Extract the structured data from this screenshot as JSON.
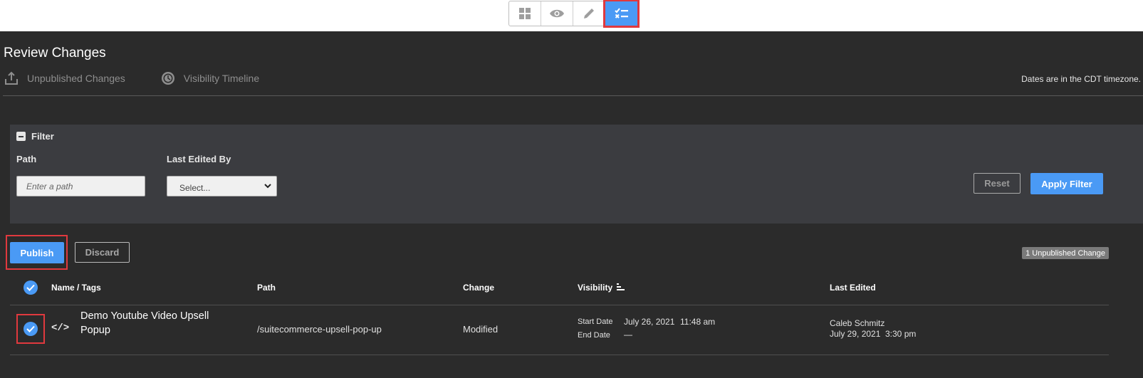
{
  "toolbar": {
    "modes": [
      {
        "icon": "grid-icon",
        "active": false
      },
      {
        "icon": "eye-icon",
        "active": false
      },
      {
        "icon": "pencil-icon",
        "active": false
      },
      {
        "icon": "checklist-icon",
        "active": true
      }
    ],
    "accent": "#4a9af5",
    "highlight": "#e0393e"
  },
  "page": {
    "title": "Review Changes",
    "tabs": [
      {
        "label": "Unpublished Changes",
        "icon": "upload-icon"
      },
      {
        "label": "Visibility Timeline",
        "icon": "clock-icon"
      }
    ],
    "timezone_note": "Dates are in the CDT timezone."
  },
  "filter": {
    "heading": "Filter",
    "path_label": "Path",
    "path_placeholder": "Enter a path",
    "edited_by_label": "Last Edited By",
    "edited_by_value": "Select...",
    "reset_label": "Reset",
    "apply_label": "Apply Filter"
  },
  "actions": {
    "publish_label": "Publish",
    "discard_label": "Discard",
    "count_badge": "1 Unpublished Change"
  },
  "table": {
    "headers": {
      "name": "Name / Tags",
      "path": "Path",
      "change": "Change",
      "visibility": "Visibility",
      "last_edited": "Last Edited"
    },
    "rows": [
      {
        "name": "Demo Youtube Video Upsell Popup",
        "type_icon": "</>",
        "path": "/suitecommerce-upsell-pop-up",
        "change": "Modified",
        "start_label": "Start Date",
        "start_date": "July 26, 2021",
        "start_time": "11:48 am",
        "end_label": "End Date",
        "end_date": "—",
        "editor": "Caleb Schmitz",
        "edited_date": "July 29, 2021",
        "edited_time": "3:30 pm"
      }
    ]
  }
}
